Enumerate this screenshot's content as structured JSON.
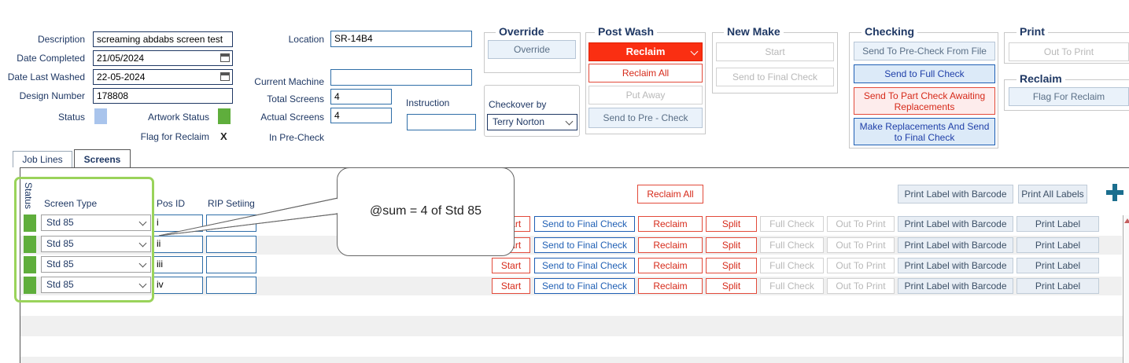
{
  "fields": {
    "description_label": "Description",
    "description_value": "screaming abdabs screen test",
    "date_completed_label": "Date Completed",
    "date_completed_value": "21/05/2024",
    "date_last_washed_label": "Date Last Washed",
    "date_last_washed_value": "22-05-2024",
    "design_number_label": "Design Number",
    "design_number_value": "178808",
    "status_label": "Status",
    "artwork_status_label": "Artwork Status",
    "flag_for_reclaim_label": "Flag for Reclaim",
    "flag_for_reclaim_value": "X",
    "location_label": "Location",
    "location_value": "SR-14B4",
    "current_machine_label": "Current Machine",
    "current_machine_value": "",
    "total_screens_label": "Total Screens",
    "total_screens_value": "4",
    "actual_screens_label": "Actual Screens",
    "actual_screens_value": "4",
    "in_pre_check_label": "In Pre-Check",
    "instruction_label": "Instruction",
    "instruction_value": "",
    "checkover_label": "Checkover by",
    "checkover_value": "Terry Norton"
  },
  "groups": {
    "override": {
      "title": "Override",
      "button": "Override"
    },
    "post_wash": {
      "title": "Post Wash",
      "select_value": "Reclaim",
      "reclaim_all": "Reclaim All",
      "put_away": "Put Away",
      "send_pre_check": "Send to Pre - Check"
    },
    "new_make": {
      "title": "New Make",
      "start": "Start",
      "send_final": "Send to Final Check"
    },
    "checking": {
      "title": "Checking",
      "pre_check_file": "Send To Pre-Check From File",
      "full_check": "Send to Full Check",
      "part_check": "Send To Part Check Awaiting Replacements",
      "make_replacements": "Make Replacements And Send to Final Check"
    },
    "print": {
      "title": "Print",
      "out_to_print": "Out To Print"
    },
    "reclaim": {
      "title": "Reclaim",
      "flag": "Flag For Reclaim"
    }
  },
  "tabs": [
    "Job Lines",
    "Screens"
  ],
  "screens": {
    "status_header": "Status",
    "screen_type_header": "Screen Type",
    "pos_id_header": "Pos ID",
    "rip_header": "RIP Setiing",
    "reclaim_all": "Reclaim All",
    "print_label_barcode_header": "Print Label with Barcode",
    "print_all_labels": "Print All Labels",
    "callout": "@sum = 4 of Std 85",
    "actions": {
      "start": "Start",
      "send_final": "Send to Final Check",
      "reclaim": "Reclaim",
      "split": "Split",
      "full_check": "Full Check",
      "out_to_print": "Out To Print",
      "print_label_barcode": "Print Label with Barcode",
      "print_label": "Print Label"
    },
    "rows": [
      {
        "screen_type": "Std 85",
        "pos_id": "i",
        "rip": ""
      },
      {
        "screen_type": "Std 85",
        "pos_id": "ii",
        "rip": ""
      },
      {
        "screen_type": "Std 85",
        "pos_id": "iii",
        "rip": ""
      },
      {
        "screen_type": "Std 85",
        "pos_id": "iv",
        "rip": ""
      }
    ]
  },
  "colors": {
    "status_swatch": "#a9c4ec",
    "artwork_swatch": "#5fae3c",
    "row_status": "#5fae3c",
    "highlight_border": "#9ad35a",
    "plus_icon": "#1b6e8e"
  }
}
